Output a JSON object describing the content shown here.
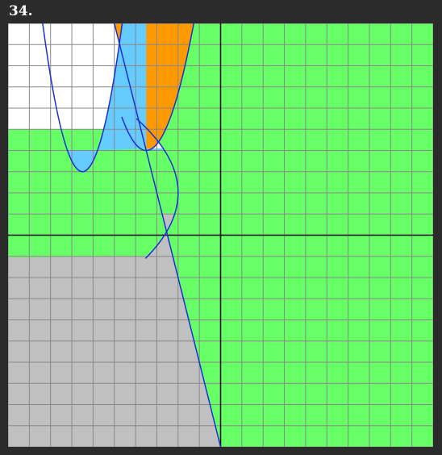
{
  "problem": {
    "number": "34."
  },
  "graph": {
    "x_range": [
      -20,
      20
    ],
    "y_range": [
      -20,
      20
    ],
    "grid_step": 2,
    "colors": {
      "background": "#66ff66",
      "white_region": "#ffffff",
      "orange_region": "#ff9900",
      "blue_region": "#66ccff",
      "gray_region": "#c0c0c0",
      "grid": "#888888",
      "axes": "#000000",
      "curves": "#1a2fd6"
    },
    "curves": {
      "parabola_up": {
        "vertex": [
          -13,
          6
        ],
        "a": 1
      },
      "parabola_sideways": {
        "vertex": [
          -4,
          4
        ],
        "b": 0.08
      },
      "line": {
        "points": [
          [
            -7,
            8
          ],
          [
            0,
            -20
          ]
        ]
      },
      "parabola_orange": {
        "vertex": [
          -7,
          8
        ],
        "a": 0.6
      }
    }
  }
}
